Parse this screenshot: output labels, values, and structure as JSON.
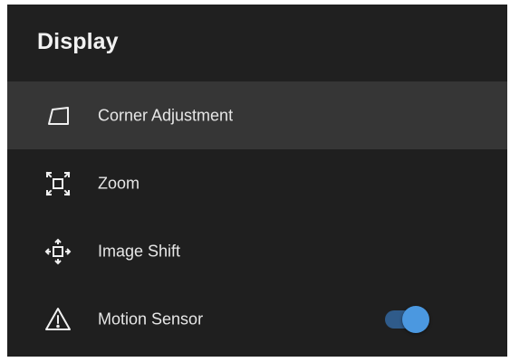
{
  "header": {
    "title": "Display"
  },
  "menu": {
    "items": [
      {
        "label": "Corner Adjustment",
        "icon": "corner-adjustment-icon",
        "selected": true
      },
      {
        "label": "Zoom",
        "icon": "zoom-icon",
        "selected": false
      },
      {
        "label": "Image Shift",
        "icon": "image-shift-icon",
        "selected": false
      },
      {
        "label": "Motion Sensor",
        "icon": "warning-icon",
        "selected": false,
        "toggle": true
      }
    ]
  },
  "colors": {
    "panel_background": "#1f1f1f",
    "selected_background": "#363636",
    "text": "#e6e6e6",
    "toggle_knob": "#4b98e0",
    "toggle_track": "#2f5b8a"
  }
}
